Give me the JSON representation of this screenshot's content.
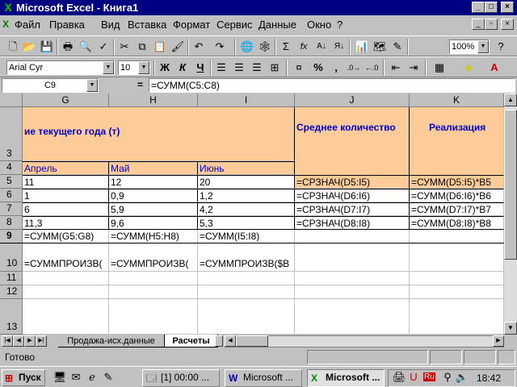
{
  "window": {
    "title": "Microsoft Excel - Книга1",
    "app_icon": "excel-icon"
  },
  "menu": {
    "items": [
      "Файл",
      "Правка",
      "Вид",
      "Вставка",
      "Формат",
      "Сервис",
      "Данные",
      "Окно",
      "?"
    ]
  },
  "format": {
    "font": "Arial Cyr",
    "size": "10",
    "bold": "Ж",
    "italic": "К",
    "underline": "Ч",
    "percent": "%",
    "comma": ","
  },
  "standard": {
    "zoom": "100%",
    "sigma": "Σ",
    "fx": "fx"
  },
  "formula_bar": {
    "cell_ref": "C9",
    "eq": "=",
    "formula": "=СУММ(C5:C8)"
  },
  "columns": [
    "G",
    "H",
    "I",
    "J",
    "K"
  ],
  "rows": [
    "3",
    "4",
    "5",
    "6",
    "7",
    "8",
    "9",
    "10",
    "11",
    "12",
    "13"
  ],
  "sheet": {
    "r3_header": "ие текущего года (т)",
    "j3": "Среднее количество",
    "k3": "Реализация",
    "months": [
      "Апрель",
      "Май",
      "Июнь"
    ],
    "data": [
      [
        "11",
        "12",
        "20",
        "=СРЗНАЧ(D5:I5)",
        "=СУММ(D5:I5)*B5"
      ],
      [
        "1",
        "0,9",
        "1,2",
        "=СРЗНАЧ(D6:I6)",
        "=СУММ(D6:I6)*B6"
      ],
      [
        "6",
        "5,9",
        "4,2",
        "=СРЗНАЧ(D7:I7)",
        "=СУММ(D7:I7)*B7"
      ],
      [
        "11,3",
        "9,6",
        "5,3",
        "=СРЗНАЧ(D8:I8)",
        "=СУММ(D8:I8)*B8"
      ]
    ],
    "r9": [
      "=СУММ(G5:G8)",
      "=СУММ(H5:H8)",
      "=СУММ(I5:I8)"
    ],
    "r10": [
      "=СУММПРОИЗВ(",
      "=СУММПРОИЗВ(",
      "=СУММПРОИЗВ($B"
    ]
  },
  "tabs": {
    "sheets": [
      "Продажа-исх.данные",
      "Расчеты"
    ],
    "active": "Расчеты"
  },
  "status": {
    "text": "Готово"
  },
  "taskbar": {
    "start": "Пуск",
    "tasks": [
      "[1] 00:00 ...",
      "Microsoft ...",
      "Microsoft ..."
    ],
    "lang": "Ru",
    "time": "18:42"
  }
}
